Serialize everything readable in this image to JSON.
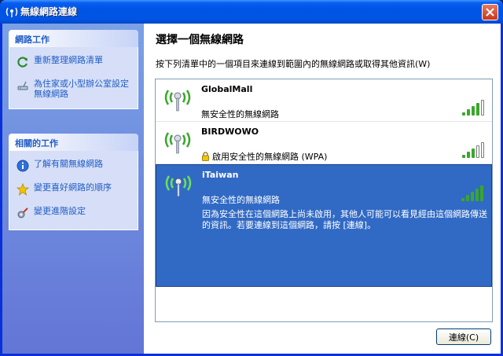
{
  "window": {
    "title": "無線網路連線"
  },
  "tasks": {
    "header": "網路工作",
    "items": [
      {
        "label": "重新整理網路清單",
        "icon": "refresh-icon"
      },
      {
        "label": "為住家或小型辦公室設定無線網路",
        "icon": "network-setup-icon"
      }
    ]
  },
  "related": {
    "header": "相關的工作",
    "items": [
      {
        "label": "了解有關無線網路",
        "icon": "info-icon"
      },
      {
        "label": "變更喜好網路的順序",
        "icon": "star-icon"
      },
      {
        "label": "變更進階設定",
        "icon": "settings-icon"
      }
    ]
  },
  "main": {
    "heading": "選擇一個無線網路",
    "instruction": "按下列清單中的一個項目來連線到範圍內的無線網路或取得其他資訊(W)"
  },
  "networks": [
    {
      "name": "GlobalMall",
      "security": "無安全性的無線網路",
      "secured": false,
      "signal_bars": 4,
      "selected": false
    },
    {
      "name": "BIRDWOWO",
      "security": "啟用安全性的無線網路 (WPA)",
      "secured": true,
      "signal_bars": 3,
      "selected": false
    },
    {
      "name": "iTaiwan",
      "security": "無安全性的無線網路",
      "secured": false,
      "signal_bars": 5,
      "selected": true,
      "description": "因為安全性在這個網路上尚未啟用，其他人可能可以看見經由這個網路傳送的資訊。若要連線到這個網路，請按 [連線]。"
    }
  ],
  "connect_button": {
    "label": "連線(C)"
  },
  "colors": {
    "accent": "#316ac5",
    "signal_green": "#3aa72c",
    "link": "#215dc6"
  }
}
